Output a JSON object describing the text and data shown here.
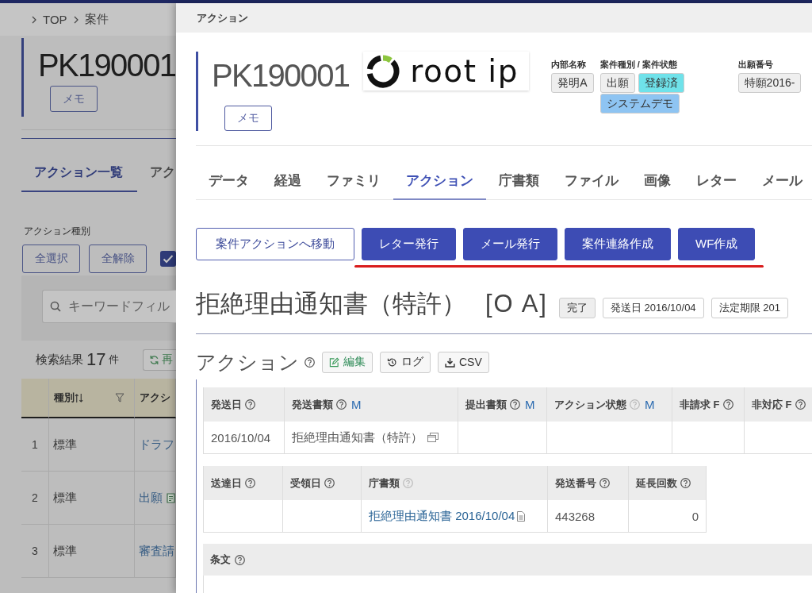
{
  "background_page": {
    "breadcrumb": [
      "TOP",
      "案件"
    ],
    "case_number": "PK190001",
    "memo_button": "メモ",
    "tabs": [
      {
        "label": "アクション一覧",
        "selected": true
      },
      {
        "label": "アク",
        "selected": false
      }
    ],
    "filter": {
      "label": "アクション種別",
      "buttons": [
        "全選択",
        "全解除"
      ],
      "checkbox_checked": true,
      "search": {
        "placeholder": "キーワードフィル"
      }
    },
    "results": {
      "label": "検索結果",
      "count": "17",
      "unit": "件",
      "reload_button": "再"
    },
    "table": {
      "columns": [
        {
          "label": "種別",
          "kind": "sortable"
        },
        {
          "label": "アクシ",
          "kind": "plain"
        }
      ],
      "rows": [
        {
          "number": "1",
          "type": "標準",
          "action": "ドラフ",
          "note_icon": false
        },
        {
          "number": "2",
          "type": "標準",
          "action": "出願",
          "note_icon": true
        },
        {
          "number": "3",
          "type": "標準",
          "action": "審査請",
          "note_icon": false
        }
      ]
    }
  },
  "dialog": {
    "title": "アクション",
    "case_number": "PK190001",
    "logo_text": "root ip",
    "memo_button": "メモ",
    "fields": [
      {
        "label": "内部名称",
        "chips": [
          {
            "text": "発明A",
            "color": "#efefef"
          }
        ]
      },
      {
        "label": "案件種別 / 案件状態",
        "chips": [
          {
            "text": "出願",
            "color": "#efefef"
          },
          {
            "text": "登録済",
            "color": "#6fe2ea"
          },
          {
            "text": "システムデモ",
            "color": "#8ec4f2"
          }
        ]
      },
      {
        "label": "出願番号",
        "chips": [
          {
            "text": "特願2016-",
            "color": "#efefef"
          }
        ]
      }
    ],
    "tabs": [
      {
        "label": "データ",
        "selected": false
      },
      {
        "label": "経過",
        "selected": false
      },
      {
        "label": "ファミリ",
        "selected": false
      },
      {
        "label": "アクション",
        "selected": true
      },
      {
        "label": "庁書類",
        "selected": false
      },
      {
        "label": "ファイル",
        "selected": false
      },
      {
        "label": "画像",
        "selected": false
      },
      {
        "label": "レター",
        "selected": false
      },
      {
        "label": "メール",
        "selected": false
      }
    ],
    "actions": [
      {
        "label": "案件アクションへ移動",
        "kind": "outline"
      },
      {
        "label": "レター発行",
        "kind": "primary"
      },
      {
        "label": "メール発行",
        "kind": "primary"
      },
      {
        "label": "案件連絡作成",
        "kind": "primary"
      },
      {
        "label": "WF作成",
        "kind": "primary"
      }
    ],
    "document": {
      "title": "拒絶理由通知書（特許）",
      "code": "[O A]",
      "badges": [
        {
          "text": "完了",
          "kind": "filled"
        },
        {
          "text": "発送日 2016/10/04",
          "kind": "outline"
        },
        {
          "text": "法定期限 201",
          "kind": "outline"
        }
      ]
    },
    "section": {
      "title": "アクション",
      "tools": [
        {
          "label": "編集",
          "kind": "edit"
        },
        {
          "label": "ログ",
          "kind": "history"
        },
        {
          "label": "CSV",
          "kind": "download"
        }
      ]
    },
    "action_table": {
      "columns": [
        {
          "label": "発送日",
          "help_dimmed": false
        },
        {
          "label": "発送書類",
          "help_dimmed": false,
          "marker": "M"
        },
        {
          "label": "提出書類",
          "help_dimmed": false,
          "marker": "M"
        },
        {
          "label": "アクション状態",
          "help_dimmed": true,
          "marker": "M"
        },
        {
          "label": "非請求 F",
          "help_dimmed": false
        },
        {
          "label": "非対応 F",
          "help_dimmed": false
        }
      ],
      "rows": [
        {
          "cells": [
            {
              "kind": "text",
              "text": "2016/10/04"
            },
            {
              "kind": "copy",
              "text": "拒絶理由通知書（特許）"
            },
            {
              "kind": "empty"
            },
            {
              "kind": "empty"
            },
            {
              "kind": "empty"
            },
            {
              "kind": "empty"
            }
          ]
        }
      ]
    },
    "delivery_table": {
      "columns": [
        {
          "label": "送達日",
          "help_dimmed": false
        },
        {
          "label": "受領日",
          "help_dimmed": false
        },
        {
          "label": "庁書類",
          "help_dimmed": true
        },
        {
          "label": "発送番号",
          "help_dimmed": false
        },
        {
          "label": "延長回数",
          "help_dimmed": false
        }
      ],
      "rows": [
        {
          "cells": [
            {
              "kind": "empty"
            },
            {
              "kind": "empty"
            },
            {
              "kind": "link",
              "text": "拒絶理由通知書 2016/10/04"
            },
            {
              "kind": "text",
              "text": "443268"
            },
            {
              "kind": "number",
              "text": "0"
            }
          ]
        }
      ]
    },
    "articles": {
      "label": "条文"
    }
  }
}
